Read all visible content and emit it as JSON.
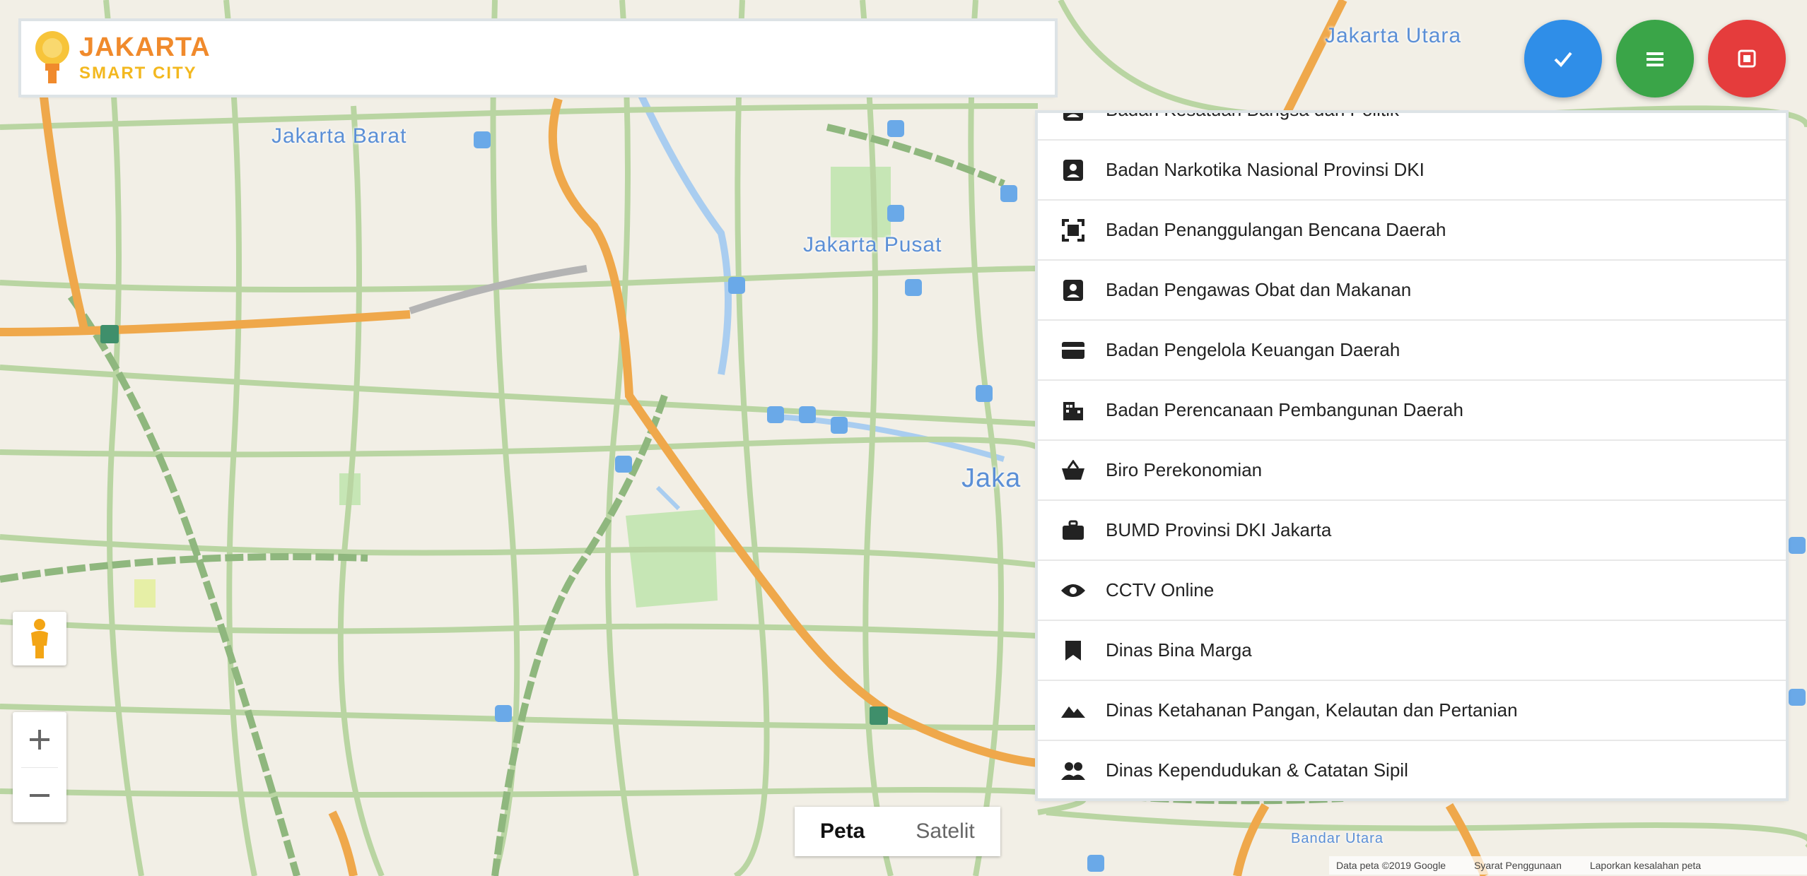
{
  "header": {
    "logo_title": "JAKARTA",
    "logo_subtitle": "SMART CITY"
  },
  "buttons": {
    "blue": {
      "icon": "check-icon",
      "color": "#2f8ee8"
    },
    "green": {
      "icon": "menu-icon",
      "color": "#3aa548"
    },
    "red": {
      "icon": "stop-icon",
      "color": "#e53c3c"
    }
  },
  "map": {
    "labels": {
      "jakarta_barat": "Jakarta Barat",
      "jakarta_pusat": "Jakarta Pusat",
      "jakarta_utara": "Jakarta Utara",
      "jakarta_partial": "Jaka",
      "bandar": "Bandar Utara"
    },
    "maptype": {
      "map": "Peta",
      "satellite": "Satelit"
    },
    "attribution": [
      "Data peta ©2019 Google",
      "Syarat Penggunaan",
      "Laporkan kesalahan peta"
    ]
  },
  "layers": [
    {
      "label": "Badan Kesatuan Bangsa dan Politik",
      "icon": "id-badge-icon"
    },
    {
      "label": "Badan Narkotika Nasional Provinsi DKI",
      "icon": "id-badge-icon"
    },
    {
      "label": "Badan Penanggulangan Bencana Daerah",
      "icon": "expand-frame-icon"
    },
    {
      "label": "Badan Pengawas Obat dan Makanan",
      "icon": "id-badge-icon"
    },
    {
      "label": "Badan Pengelola Keuangan Daerah",
      "icon": "wallet-icon"
    },
    {
      "label": "Badan Perencanaan Pembangunan Daerah",
      "icon": "building-icon"
    },
    {
      "label": "Biro Perekonomian",
      "icon": "basket-icon"
    },
    {
      "label": "BUMD Provinsi DKI Jakarta",
      "icon": "briefcase-icon"
    },
    {
      "label": "CCTV Online",
      "icon": "eye-icon"
    },
    {
      "label": "Dinas Bina Marga",
      "icon": "bookmark-icon"
    },
    {
      "label": "Dinas Ketahanan Pangan, Kelautan dan Pertanian",
      "icon": "landscape-icon"
    },
    {
      "label": "Dinas Kependudukan & Catatan Sipil",
      "icon": "people-icon"
    }
  ]
}
